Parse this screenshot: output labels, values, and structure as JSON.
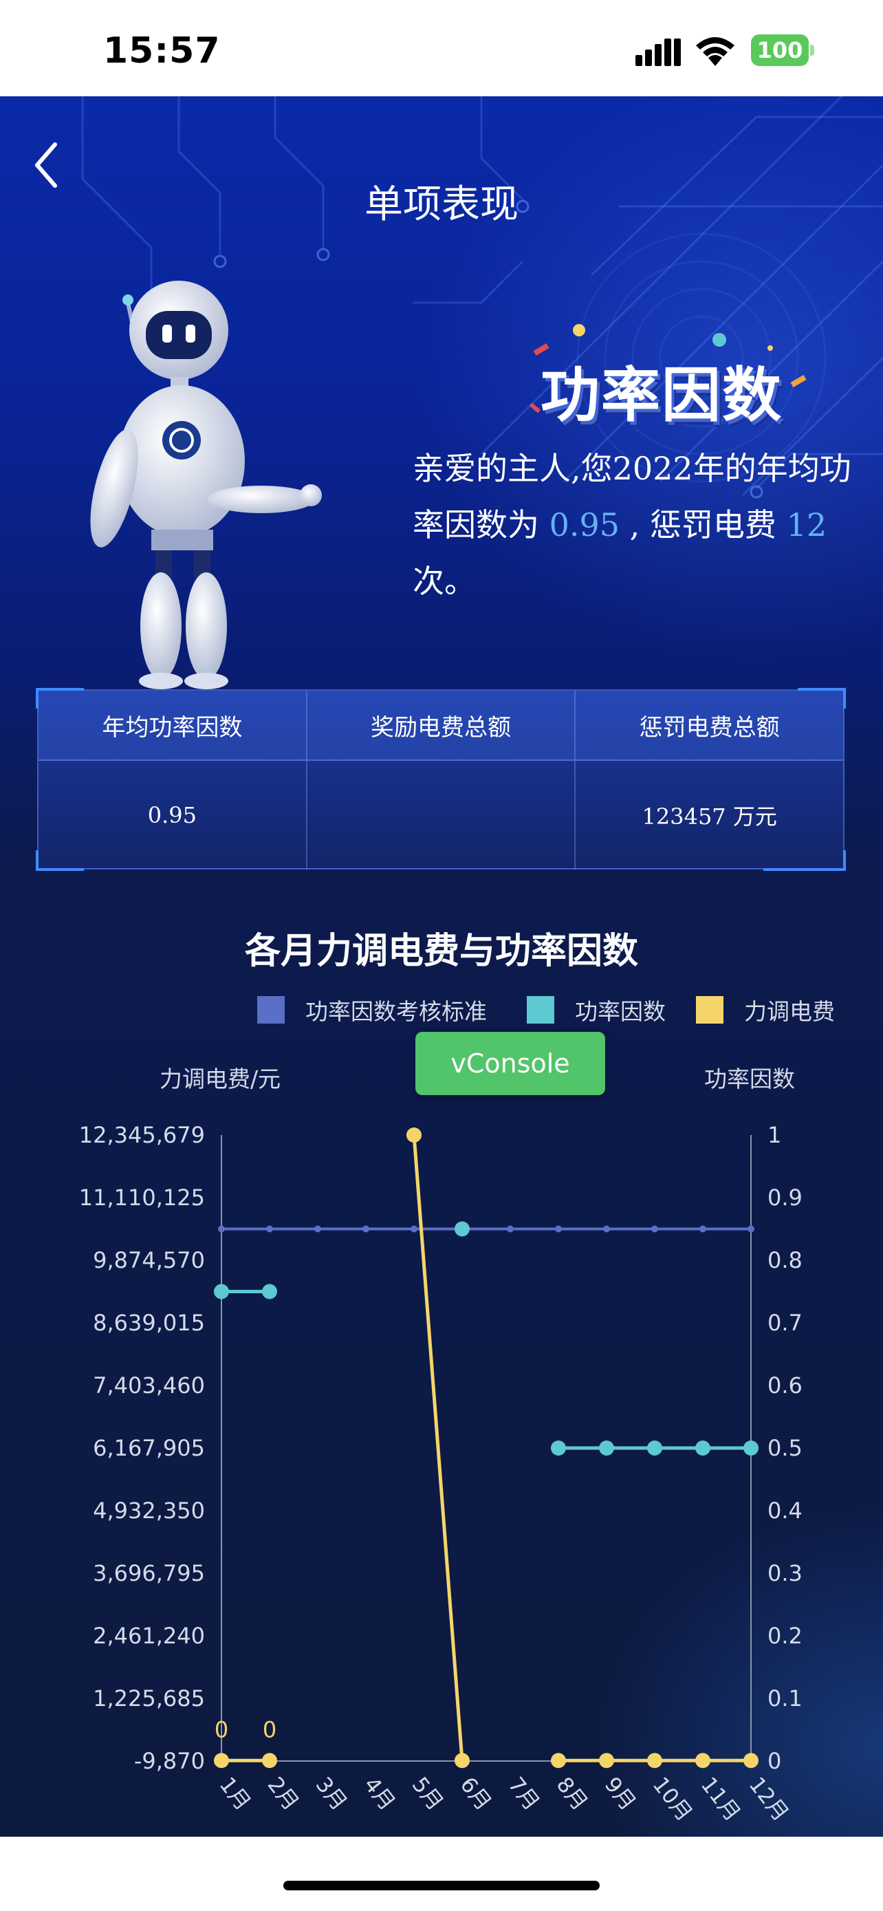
{
  "status_bar": {
    "time": "15:57",
    "battery": "100"
  },
  "page": {
    "title": "单项表现"
  },
  "heading": "功率因数",
  "description": {
    "prefix": "亲爱的主人,您2022年的年均功率因数为 ",
    "power_factor": "0.95",
    "middle": " , 惩罚电费 ",
    "penalty_count": "12",
    "suffix": " 次。"
  },
  "stats": {
    "headers": [
      "年均功率因数",
      "奖励电费总额",
      "惩罚电费总额"
    ],
    "values": [
      "0.95",
      "",
      "123457 万元"
    ]
  },
  "chart": {
    "title": "各月力调电费与功率因数"
  },
  "colors": {
    "standard": "#5b6fc6",
    "power_factor": "#5ec8d3",
    "fee": "#f5d56a"
  },
  "chart_data": {
    "type": "line",
    "title": "各月力调电费与功率因数",
    "categories": [
      "1月",
      "2月",
      "3月",
      "4月",
      "5月",
      "6月",
      "7月",
      "8月",
      "9月",
      "10月",
      "11月",
      "12月"
    ],
    "legend": [
      "功率因数考核标准",
      "功率因数",
      "力调电费"
    ],
    "legend_position": "top-right",
    "y_left": {
      "label": "力调电费/元",
      "ticks": [
        "12,345,679",
        "11,110,125",
        "9,874,570",
        "8,639,015",
        "7,403,460",
        "6,167,905",
        "4,932,350",
        "3,696,795",
        "2,461,240",
        "1,225,685",
        "-9,870"
      ],
      "range": [
        -9870,
        12345679
      ]
    },
    "y_right": {
      "label": "功率因数",
      "ticks": [
        "1",
        "0.9",
        "0.8",
        "0.7",
        "0.6",
        "0.5",
        "0.4",
        "0.3",
        "0.2",
        "0.1",
        "0"
      ],
      "range": [
        0,
        1
      ]
    },
    "series": [
      {
        "name": "功率因数考核标准",
        "axis": "right",
        "values": [
          0.85,
          0.85,
          0.85,
          0.85,
          0.85,
          0.85,
          0.85,
          0.85,
          0.85,
          0.85,
          0.85,
          0.85
        ]
      },
      {
        "name": "功率因数",
        "axis": "right",
        "values": [
          0.75,
          0.75,
          null,
          null,
          null,
          0.85,
          null,
          0.5,
          0.5,
          0.5,
          0.5,
          0.5
        ]
      },
      {
        "name": "力调电费",
        "axis": "left",
        "values": [
          0,
          0,
          null,
          null,
          12345679,
          0,
          null,
          0,
          0,
          0,
          0,
          0
        ]
      }
    ],
    "data_labels": [
      "0",
      "0"
    ],
    "grid": false
  },
  "vconsole": {
    "label": "vConsole"
  }
}
